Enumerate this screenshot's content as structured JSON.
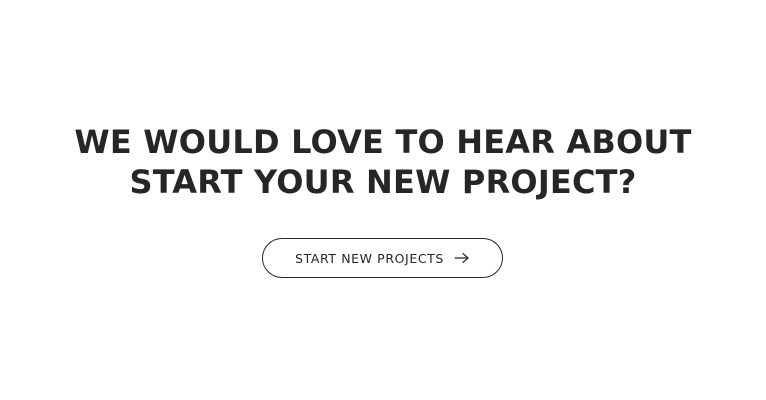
{
  "cta": {
    "heading_line1": "WE WOULD LOVE TO HEAR ABOUT",
    "heading_line2": "START YOUR NEW PROJECT?",
    "button_label": "START NEW PROJECTS",
    "button_icon": "arrow-right-icon"
  },
  "colors": {
    "text": "#262626",
    "background": "#ffffff",
    "button_border": "#262626"
  }
}
